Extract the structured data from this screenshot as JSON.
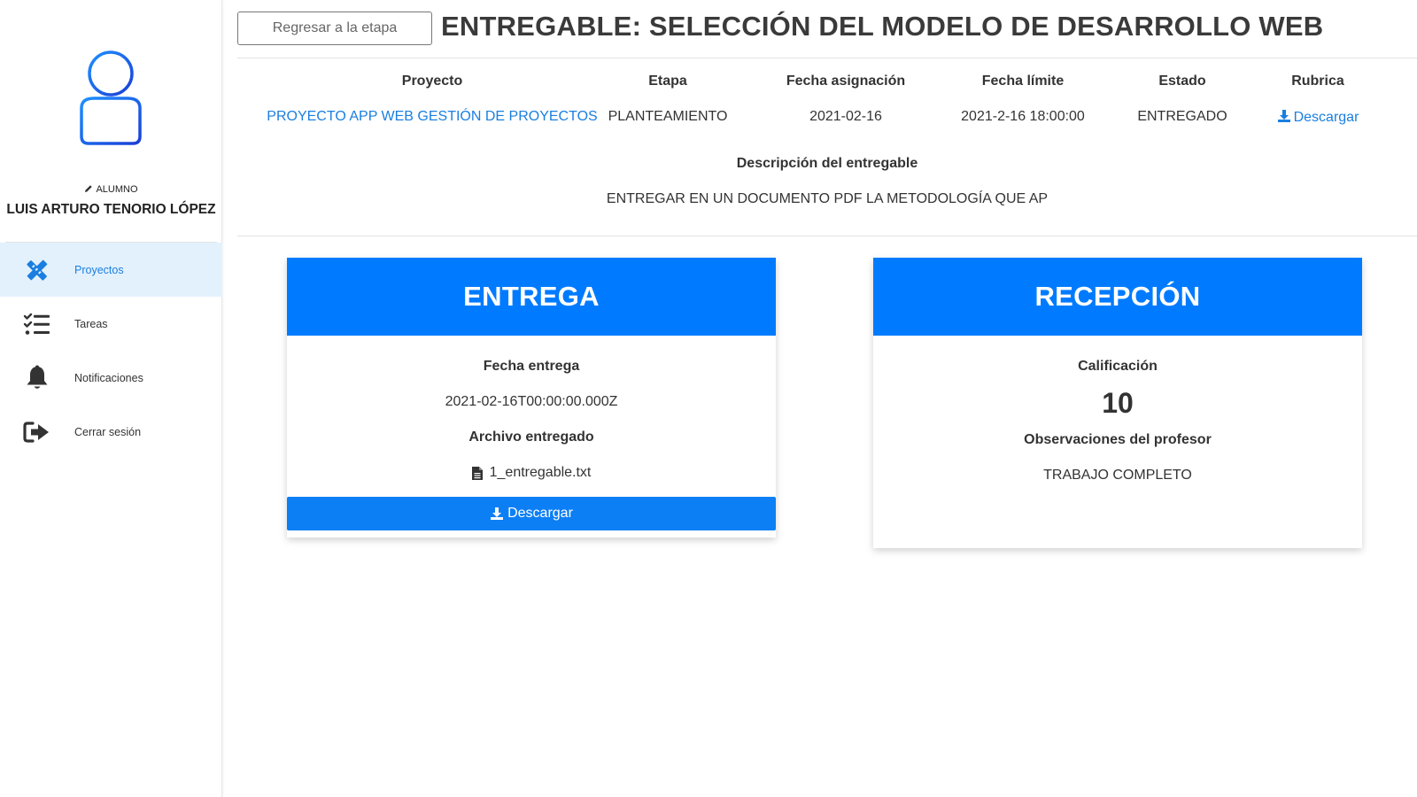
{
  "sidebar": {
    "role": "ALUMNO",
    "user_name": "LUIS ARTURO TENORIO LÓPEZ",
    "items": [
      {
        "label": "Proyectos",
        "icon": "pencil-ruler-icon",
        "active": true
      },
      {
        "label": "Tareas",
        "icon": "task-list-icon",
        "active": false
      },
      {
        "label": "Notificaciones",
        "icon": "bell-icon",
        "active": false
      },
      {
        "label": "Cerrar sesión",
        "icon": "logout-icon",
        "active": false
      }
    ]
  },
  "header": {
    "back_label": "Regresar a la etapa",
    "title": "ENTREGABLE: SELECCIÓN DEL MODELO DE DESARROLLO WEB"
  },
  "info": {
    "columns": [
      {
        "header": "Proyecto",
        "value": "PROYECTO APP WEB GESTIÓN DE PROYECTOS"
      },
      {
        "header": "Etapa",
        "value": "PLANTEAMIENTO"
      },
      {
        "header": "Fecha asignación",
        "value": "2021-02-16"
      },
      {
        "header": "Fecha límite",
        "value": "2021-2-16 18:00:00"
      },
      {
        "header": "Estado",
        "value": "ENTREGADO"
      },
      {
        "header": "Rubrica",
        "value": "Descargar"
      }
    ],
    "description_header": "Descripción del entregable",
    "description": "ENTREGAR EN UN DOCUMENTO PDF LA METODOLOGÍA QUE AP"
  },
  "entrega": {
    "title": "ENTREGA",
    "date_label": "Fecha entrega",
    "date_value": "2021-02-16T00:00:00.000Z",
    "file_label": "Archivo entregado",
    "file_name": "1_entregable.txt",
    "download_label": "Descargar"
  },
  "recepcion": {
    "title": "RECEPCIÓN",
    "grade_label": "Calificación",
    "grade": "10",
    "notes_label": "Observaciones del profesor",
    "notes": "TRABAJO COMPLETO"
  },
  "colors": {
    "primary": "#007bff",
    "link": "#1a7fe0",
    "active_bg": "#e3f1fd"
  }
}
